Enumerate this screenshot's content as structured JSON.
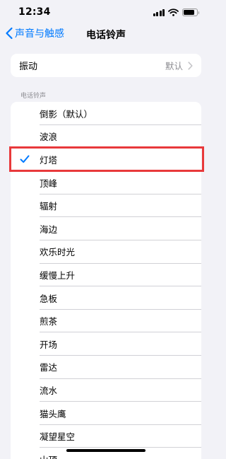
{
  "status_bar": {
    "time": "12:34",
    "battery_level": 0.85
  },
  "nav": {
    "back_label": "声音与触感",
    "title": "电话铃声"
  },
  "vibration": {
    "label": "振动",
    "value": "默认"
  },
  "ringtones": {
    "section_header": "电话铃声",
    "items": [
      {
        "label": "倒影（默认）",
        "selected": false
      },
      {
        "label": "波浪",
        "selected": false
      },
      {
        "label": "灯塔",
        "selected": true
      },
      {
        "label": "顶峰",
        "selected": false
      },
      {
        "label": "辐射",
        "selected": false
      },
      {
        "label": "海边",
        "selected": false
      },
      {
        "label": "欢乐时光",
        "selected": false
      },
      {
        "label": "缓慢上升",
        "selected": false
      },
      {
        "label": "急板",
        "selected": false
      },
      {
        "label": "煎茶",
        "selected": false
      },
      {
        "label": "开场",
        "selected": false
      },
      {
        "label": "雷达",
        "selected": false
      },
      {
        "label": "流水",
        "selected": false
      },
      {
        "label": "猫头鹰",
        "selected": false
      },
      {
        "label": "凝望星空",
        "selected": false
      },
      {
        "label": "山顶",
        "selected": false
      }
    ]
  },
  "colors": {
    "accent": "#007aff",
    "highlight_border": "#e8393b",
    "background": "#f2f2f7"
  }
}
